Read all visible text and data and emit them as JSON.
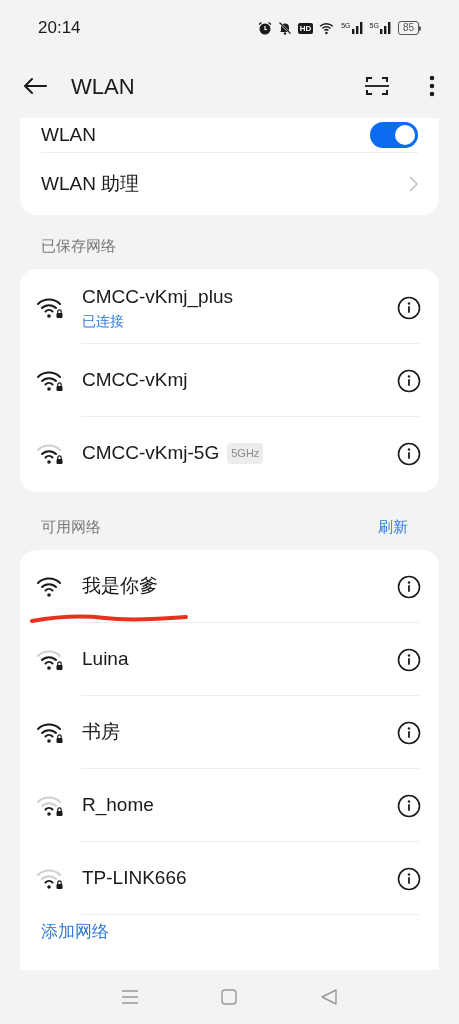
{
  "status_bar": {
    "time": "20:14",
    "hd": "HD",
    "sim_labels": [
      "5G",
      "5G"
    ],
    "battery": "85"
  },
  "header": {
    "title": "WLAN"
  },
  "main_card": {
    "toggle": {
      "label": "WLAN",
      "on": true
    },
    "assistant": {
      "label": "WLAN 助理"
    }
  },
  "saved_networks": {
    "title": "已保存网络",
    "items": [
      {
        "name": "CMCC-vKmj_plus",
        "status": "已连接",
        "kind": "strong",
        "secured": true
      },
      {
        "name": "CMCC-vKmj",
        "kind": "strong",
        "secured": true
      },
      {
        "name": "CMCC-vKmj-5G",
        "band": "5GHz",
        "kind": "medium",
        "secured": true
      }
    ]
  },
  "available_networks": {
    "title": "可用网络",
    "refresh": "刷新",
    "items": [
      {
        "name": "我是你爹",
        "kind": "strong",
        "secured": false,
        "underlined": true
      },
      {
        "name": "Luina",
        "kind": "medium",
        "secured": true,
        "underlined": false
      },
      {
        "name": "书房",
        "kind": "strong",
        "secured": true,
        "underlined": false
      },
      {
        "name": "R_home",
        "kind": "weak",
        "secured": true,
        "underlined": false
      },
      {
        "name": "TP-LINK666",
        "kind": "weak",
        "secured": true,
        "underlined": false
      }
    ],
    "add": "添加网络"
  }
}
